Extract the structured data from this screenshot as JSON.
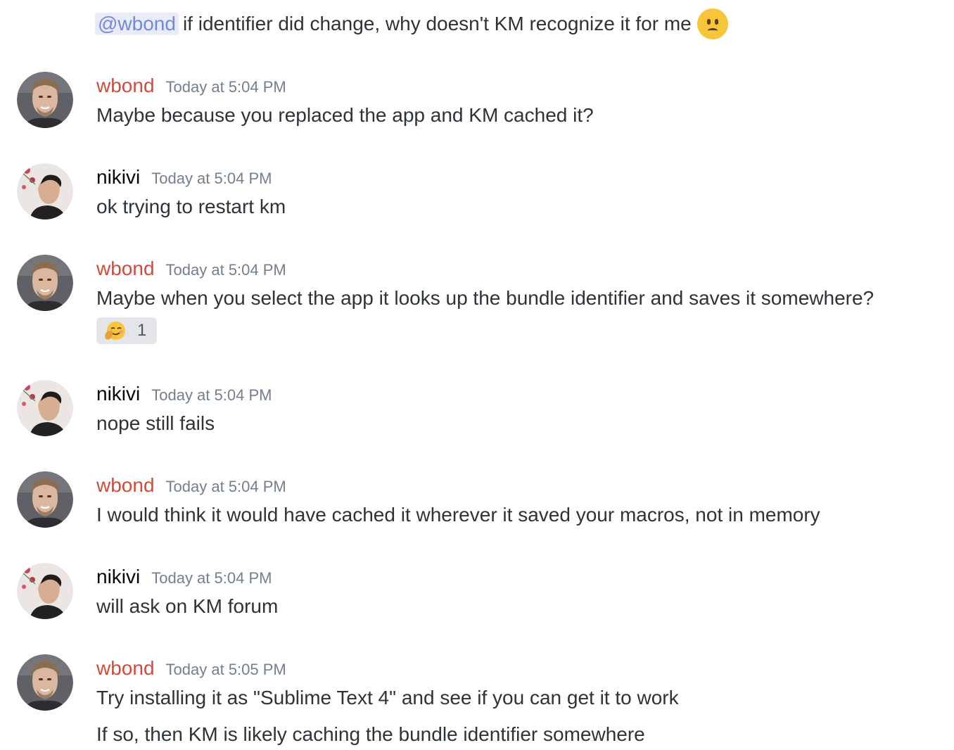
{
  "continuation": {
    "mention": "@wbond",
    "text": "if identifier did change, why doesn't KM recognize it for me",
    "emoji": "frowning-face-icon"
  },
  "messages": [
    {
      "author": "wbond",
      "timestamp": "Today at 5:04 PM",
      "lines": [
        "Maybe because you replaced the app and KM cached it?"
      ]
    },
    {
      "author": "nikivi",
      "timestamp": "Today at 5:04 PM",
      "lines": [
        "ok trying to restart km"
      ]
    },
    {
      "author": "wbond",
      "timestamp": "Today at 5:04 PM",
      "lines": [
        "Maybe when you select the app it looks up the bundle identifier and saves it somewhere?"
      ],
      "reaction": {
        "emoji": "smirking-hand-emoji-icon",
        "count": "1"
      }
    },
    {
      "author": "nikivi",
      "timestamp": "Today at 5:04 PM",
      "lines": [
        "nope still fails"
      ]
    },
    {
      "author": "wbond",
      "timestamp": "Today at 5:04 PM",
      "lines": [
        "I would think it would have cached it wherever it saved your macros, not in memory"
      ]
    },
    {
      "author": "nikivi",
      "timestamp": "Today at 5:04 PM",
      "lines": [
        "will ask on KM forum"
      ]
    },
    {
      "author": "wbond",
      "timestamp": "Today at 5:05 PM",
      "lines": [
        "Try installing it as \"Sublime Text 4\" and see if you can get it to work",
        "If so, then KM is likely caching the bundle identifier somewhere"
      ]
    }
  ],
  "colors": {
    "wbond_name": "#d24a3a",
    "nikivi_name": "#060607",
    "mention_text": "#7289da",
    "mention_bg": "#e9ecf8",
    "timestamp": "#747f8d",
    "message_text": "#2e3338",
    "reaction_bg": "#e3e5e8"
  }
}
